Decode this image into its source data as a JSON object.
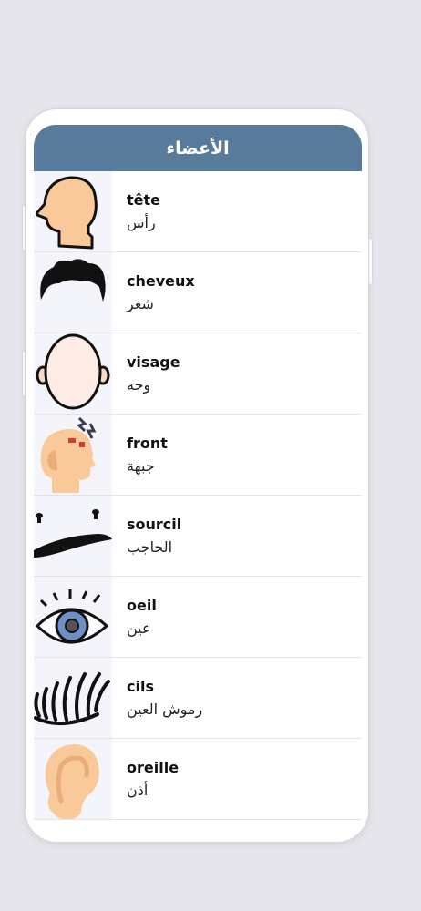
{
  "header": {
    "title": "الأعضاء"
  },
  "items": [
    {
      "fr": "tête",
      "ar": "رأس",
      "icon": "head-icon"
    },
    {
      "fr": "cheveux",
      "ar": "شعر",
      "icon": "hair-icon"
    },
    {
      "fr": "visage",
      "ar": "وجه",
      "icon": "face-icon"
    },
    {
      "fr": "front",
      "ar": "جبهة",
      "icon": "forehead-icon"
    },
    {
      "fr": "sourcil",
      "ar": "الحاجب",
      "icon": "eyebrow-icon"
    },
    {
      "fr": "oeil",
      "ar": "عين",
      "icon": "eye-icon"
    },
    {
      "fr": "cils",
      "ar": "رموش العين",
      "icon": "eyelashes-icon"
    },
    {
      "fr": "oreille",
      "ar": "أذن",
      "icon": "ear-icon"
    }
  ],
  "colors": {
    "header": "#587b9b",
    "skin": "#f9c99a",
    "background": "#e6e5ec"
  }
}
